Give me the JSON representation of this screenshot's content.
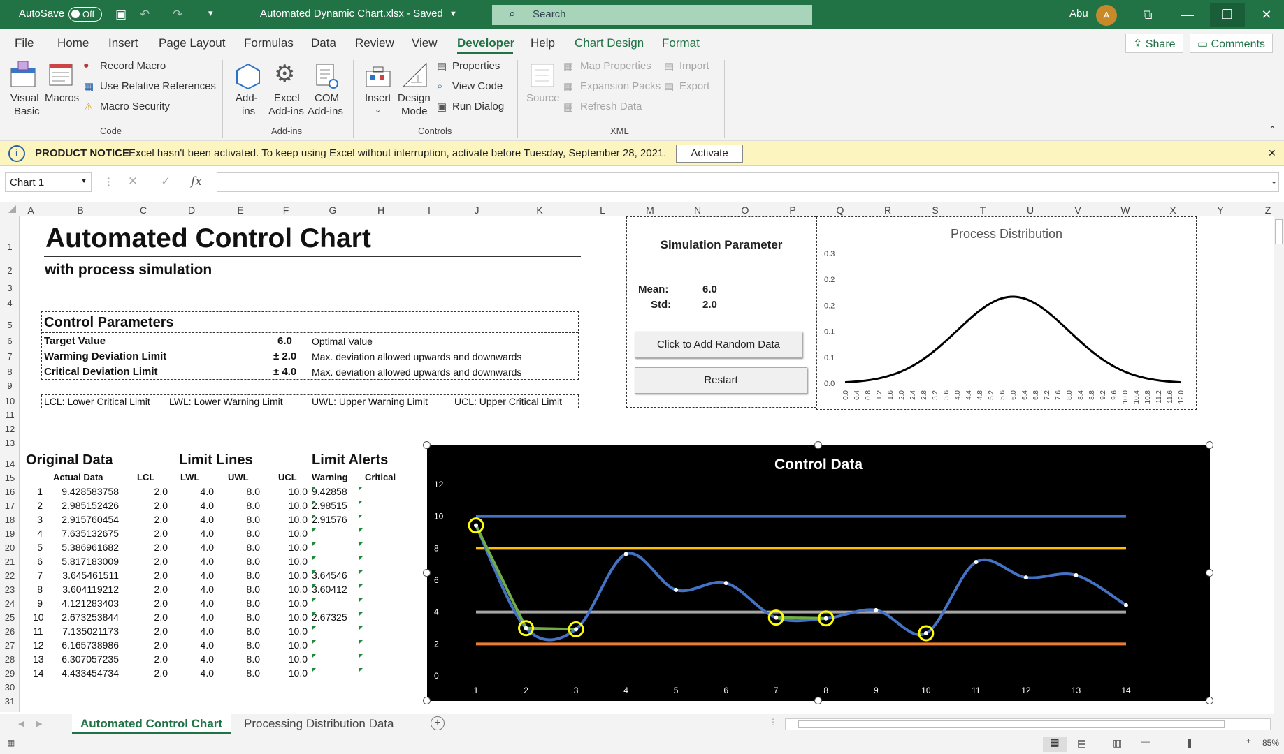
{
  "titlebar": {
    "autosave_label": "AutoSave",
    "autosave_state": "Off",
    "filename": "Automated Dynamic Chart.xlsx - Saved",
    "search_placeholder": "Search",
    "user_name": "Abu",
    "avatar_initial": "A"
  },
  "menu": {
    "items": [
      "File",
      "Home",
      "Insert",
      "Page Layout",
      "Formulas",
      "Data",
      "Review",
      "View",
      "Developer",
      "Help",
      "Chart Design",
      "Format"
    ],
    "active": "Developer",
    "share": "Share",
    "comments": "Comments"
  },
  "ribbon": {
    "code": {
      "group": "Code",
      "visual_basic_1": "Visual",
      "visual_basic_2": "Basic",
      "macros": "Macros",
      "record_macro": "Record Macro",
      "relative_refs": "Use Relative References",
      "macro_security": "Macro Security"
    },
    "addins": {
      "group": "Add-ins",
      "addins_1": "Add-",
      "addins_2": "ins",
      "excel_addins_1": "Excel",
      "excel_addins_2": "Add-ins",
      "com_addins_1": "COM",
      "com_addins_2": "Add-ins"
    },
    "controls": {
      "group": "Controls",
      "insert": "Insert",
      "design_mode_1": "Design",
      "design_mode_2": "Mode",
      "properties": "Properties",
      "view_code": "View Code",
      "run_dialog": "Run Dialog"
    },
    "xml": {
      "group": "XML",
      "source": "Source",
      "map_properties": "Map Properties",
      "expansion_packs": "Expansion Packs",
      "refresh_data": "Refresh Data",
      "import": "Import",
      "export": "Export"
    }
  },
  "notice": {
    "title": "PRODUCT NOTICE",
    "message": "Excel hasn't been activated. To keep using Excel without interruption, activate before Tuesday, September 28, 2021.",
    "button": "Activate"
  },
  "formula_bar": {
    "name_box": "Chart 1",
    "fx": "fx",
    "formula": ""
  },
  "columns": [
    "A",
    "B",
    "C",
    "D",
    "E",
    "F",
    "G",
    "H",
    "I",
    "J",
    "K",
    "L",
    "M",
    "N",
    "O",
    "P",
    "Q",
    "R",
    "S",
    "T",
    "U",
    "V",
    "W",
    "X",
    "Y",
    "Z"
  ],
  "rows": [
    "1",
    "2",
    "3",
    "4",
    "5",
    "6",
    "7",
    "8",
    "9",
    "10",
    "11",
    "12",
    "13",
    "14",
    "15",
    "16",
    "17",
    "18",
    "19",
    "20",
    "21",
    "22",
    "23",
    "24",
    "25",
    "26",
    "27",
    "28",
    "29",
    "30",
    "31"
  ],
  "sheet": {
    "title": "Automated Control Chart",
    "subtitle": "with process simulation",
    "control_params": {
      "header": "Control Parameters",
      "rows": [
        {
          "label": "Target Value",
          "value": "6.0",
          "desc": "Optimal Value"
        },
        {
          "label": "Warming Deviation Limit",
          "value": "± 2.0",
          "desc": "Max. deviation allowed upwards and downwards"
        },
        {
          "label": "Critical Deviation Limit",
          "value": "± 4.0",
          "desc": "Max. deviation allowed upwards and downwards"
        }
      ]
    },
    "legend_row": [
      "LCL: Lower Critical Limit",
      "LWL: Lower Warning Limit",
      "UWL: Upper Warning Limit",
      "UCL: Upper Critical Limit"
    ],
    "sections": {
      "original": "Original Data",
      "limits": "Limit Lines",
      "alerts": "Limit Alerts"
    },
    "headers": {
      "actual": "Actual Data",
      "lcl": "LCL",
      "lwl": "LWL",
      "uwl": "UWL",
      "ucl": "UCL",
      "warning": "Warning",
      "critical": "Critical"
    },
    "data_rows": [
      {
        "n": "1",
        "actual": "9.428583758",
        "lcl": "2.0",
        "lwl": "4.0",
        "uwl": "8.0",
        "ucl": "10.0",
        "warning": "9.42858",
        "critical": ""
      },
      {
        "n": "2",
        "actual": "2.985152426",
        "lcl": "2.0",
        "lwl": "4.0",
        "uwl": "8.0",
        "ucl": "10.0",
        "warning": "2.98515",
        "critical": ""
      },
      {
        "n": "3",
        "actual": "2.915760454",
        "lcl": "2.0",
        "lwl": "4.0",
        "uwl": "8.0",
        "ucl": "10.0",
        "warning": "2.91576",
        "critical": ""
      },
      {
        "n": "4",
        "actual": "7.635132675",
        "lcl": "2.0",
        "lwl": "4.0",
        "uwl": "8.0",
        "ucl": "10.0",
        "warning": "",
        "critical": ""
      },
      {
        "n": "5",
        "actual": "5.386961682",
        "lcl": "2.0",
        "lwl": "4.0",
        "uwl": "8.0",
        "ucl": "10.0",
        "warning": "",
        "critical": ""
      },
      {
        "n": "6",
        "actual": "5.817183009",
        "lcl": "2.0",
        "lwl": "4.0",
        "uwl": "8.0",
        "ucl": "10.0",
        "warning": "",
        "critical": ""
      },
      {
        "n": "7",
        "actual": "3.645461511",
        "lcl": "2.0",
        "lwl": "4.0",
        "uwl": "8.0",
        "ucl": "10.0",
        "warning": "3.64546",
        "critical": ""
      },
      {
        "n": "8",
        "actual": "3.604119212",
        "lcl": "2.0",
        "lwl": "4.0",
        "uwl": "8.0",
        "ucl": "10.0",
        "warning": "3.60412",
        "critical": ""
      },
      {
        "n": "9",
        "actual": "4.121283403",
        "lcl": "2.0",
        "lwl": "4.0",
        "uwl": "8.0",
        "ucl": "10.0",
        "warning": "",
        "critical": ""
      },
      {
        "n": "10",
        "actual": "2.673253844",
        "lcl": "2.0",
        "lwl": "4.0",
        "uwl": "8.0",
        "ucl": "10.0",
        "warning": "2.67325",
        "critical": ""
      },
      {
        "n": "11",
        "actual": "7.135021173",
        "lcl": "2.0",
        "lwl": "4.0",
        "uwl": "8.0",
        "ucl": "10.0",
        "warning": "",
        "critical": ""
      },
      {
        "n": "12",
        "actual": "6.165738986",
        "lcl": "2.0",
        "lwl": "4.0",
        "uwl": "8.0",
        "ucl": "10.0",
        "warning": "",
        "critical": ""
      },
      {
        "n": "13",
        "actual": "6.307057235",
        "lcl": "2.0",
        "lwl": "4.0",
        "uwl": "8.0",
        "ucl": "10.0",
        "warning": "",
        "critical": ""
      },
      {
        "n": "14",
        "actual": "4.433454734",
        "lcl": "2.0",
        "lwl": "4.0",
        "uwl": "8.0",
        "ucl": "10.0",
        "warning": "",
        "critical": ""
      }
    ],
    "simulation": {
      "header": "Simulation Parameter",
      "mean_label": "Mean:",
      "mean": "6.0",
      "std_label": "Std:",
      "std": "2.0",
      "add_button": "Click to Add Random Data",
      "restart_button": "Restart"
    }
  },
  "sheet_tabs": {
    "tabs": [
      "Automated Control Chart",
      "Processing Distribution Data"
    ],
    "active": "Automated Control Chart"
  },
  "status": {
    "zoom": "85%"
  },
  "colors": {
    "excel_green": "#217346",
    "ucl": "#4472c4",
    "uwl": "#ffc000",
    "lwl": "#a5a5a5",
    "lcl": "#ed7d31",
    "actual": "#4472c4",
    "warning_line": "#70ad47",
    "warning_marker": "#ffff00"
  },
  "chart_data": [
    {
      "type": "line",
      "title": "Process Distribution",
      "x": [
        0.0,
        0.4,
        0.8,
        1.2,
        1.6,
        2.0,
        2.4,
        2.8,
        3.2,
        3.6,
        4.0,
        4.4,
        4.8,
        5.2,
        5.6,
        6.0,
        6.4,
        6.8,
        7.2,
        7.6,
        8.0,
        8.4,
        8.8,
        9.2,
        9.6,
        10.0,
        10.4,
        10.8,
        11.2,
        11.6,
        12.0
      ],
      "x_tick_labels": [
        "0.0",
        "0.4",
        "0.8",
        "1.2",
        "1.6",
        "2.0",
        "2.4",
        "2.8",
        "3.2",
        "3.6",
        "4.0",
        "4.4",
        "4.8",
        "5.2",
        "5.6",
        "6.0",
        "6.4",
        "6.8",
        "7.2",
        "7.6",
        "8.0",
        "8.4",
        "8.8",
        "9.2",
        "9.6",
        "10.0",
        "10.4",
        "10.8",
        "11.2",
        "11.6",
        "12.0"
      ],
      "y": [
        0.0022,
        0.0036,
        0.0057,
        0.0088,
        0.0131,
        0.027,
        0.0283,
        0.0393,
        0.0529,
        0.0694,
        0.121,
        0.104,
        0.122,
        0.138,
        0.145,
        0.1995,
        0.145,
        0.138,
        0.122,
        0.104,
        0.121,
        0.0694,
        0.0529,
        0.0393,
        0.0283,
        0.027,
        0.0131,
        0.0088,
        0.0057,
        0.0036,
        0.0022
      ],
      "y_tick_labels": [
        "0.0",
        "0.1",
        "0.1",
        "0.2",
        "0.2",
        "0.3"
      ],
      "ylim": [
        0,
        0.3
      ]
    },
    {
      "type": "line",
      "title": "Control Data",
      "categories": [
        "1",
        "2",
        "3",
        "4",
        "5",
        "6",
        "7",
        "8",
        "9",
        "10",
        "11",
        "12",
        "13",
        "14"
      ],
      "ylim": [
        0,
        12
      ],
      "y_ticks": [
        "0",
        "2",
        "4",
        "6",
        "8",
        "10",
        "12"
      ],
      "series": [
        {
          "values": [
            10,
            10,
            10,
            10,
            10,
            10,
            10,
            10,
            10,
            10,
            10,
            10,
            10,
            10
          ]
        },
        {
          "values": [
            8,
            8,
            8,
            8,
            8,
            8,
            8,
            8,
            8,
            8,
            8,
            8,
            8,
            8
          ]
        },
        {
          "values": [
            4,
            4,
            4,
            4,
            4,
            4,
            4,
            4,
            4,
            4,
            4,
            4,
            4,
            4
          ]
        },
        {
          "values": [
            2,
            2,
            2,
            2,
            2,
            2,
            2,
            2,
            2,
            2,
            2,
            2,
            2,
            2
          ]
        },
        {
          "values": [
            9.43,
            2.99,
            2.92,
            7.64,
            5.39,
            5.82,
            3.65,
            3.6,
            4.12,
            2.67,
            7.14,
            6.17,
            6.31,
            4.43
          ]
        },
        {
          "values": [
            9.43,
            2.99,
            2.92,
            null,
            null,
            null,
            3.65,
            3.6,
            null,
            2.67,
            null,
            null,
            null,
            null
          ]
        }
      ]
    }
  ]
}
